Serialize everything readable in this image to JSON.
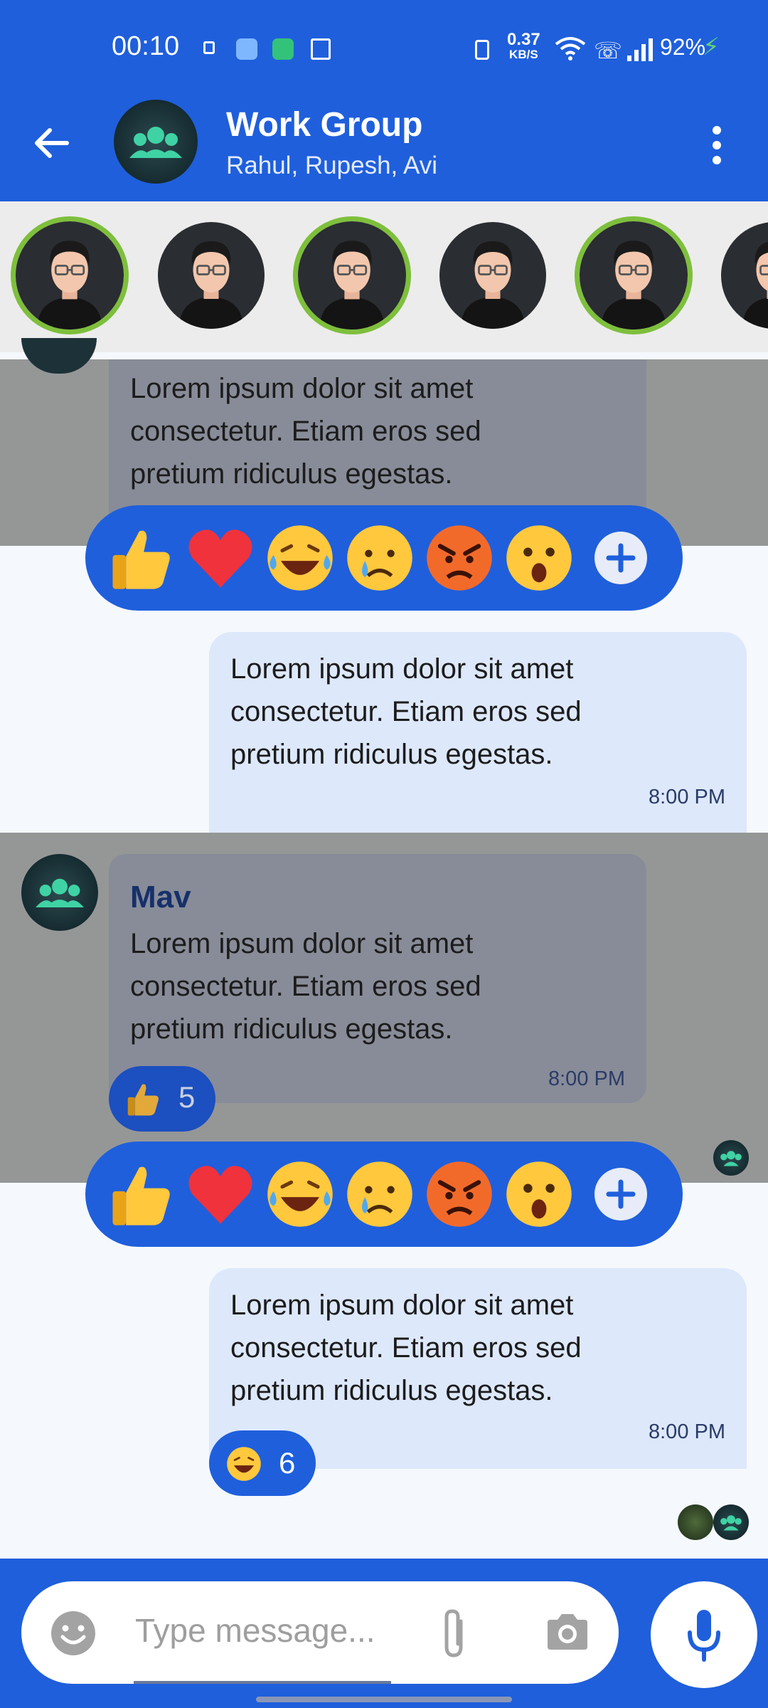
{
  "status_bar": {
    "time": "00:10",
    "net_speed_value": "0.37",
    "net_speed_unit": "KB/S",
    "battery": "92%"
  },
  "header": {
    "title": "Work Group",
    "subtitle": "Rahul, Rupesh, Avi"
  },
  "messages": [
    {
      "direction": "in",
      "text_lines": [
        "Lorem ipsum dolor sit amet",
        "consectetur. Etiam eros sed",
        "pretium ridiculus egestas."
      ]
    },
    {
      "direction": "out",
      "text_lines": [
        "Lorem ipsum dolor sit amet",
        "consectetur. Etiam eros sed",
        "pretium ridiculus egestas."
      ],
      "time": "8:00 PM"
    },
    {
      "direction": "in",
      "sender": "Mav",
      "text_lines": [
        "Lorem ipsum dolor sit amet",
        "consectetur. Etiam eros sed",
        "pretium ridiculus egestas."
      ],
      "time": "8:00 PM",
      "reaction_count": "5"
    },
    {
      "direction": "out",
      "text_lines": [
        "Lorem ipsum dolor sit amet",
        "consectetur. Etiam eros sed",
        "pretium ridiculus egestas."
      ],
      "time": "8:00 PM",
      "reaction_count": "6"
    }
  ],
  "reaction_options": [
    "thumbs-up",
    "heart",
    "laughing",
    "crying",
    "angry",
    "surprised"
  ],
  "composer": {
    "placeholder": "Type message..."
  },
  "colors": {
    "primary": "#1f5fdc",
    "incoming_bubble": "#888c98",
    "outgoing_bubble": "#dde8fb",
    "story_ring": "#7ebf3c"
  }
}
